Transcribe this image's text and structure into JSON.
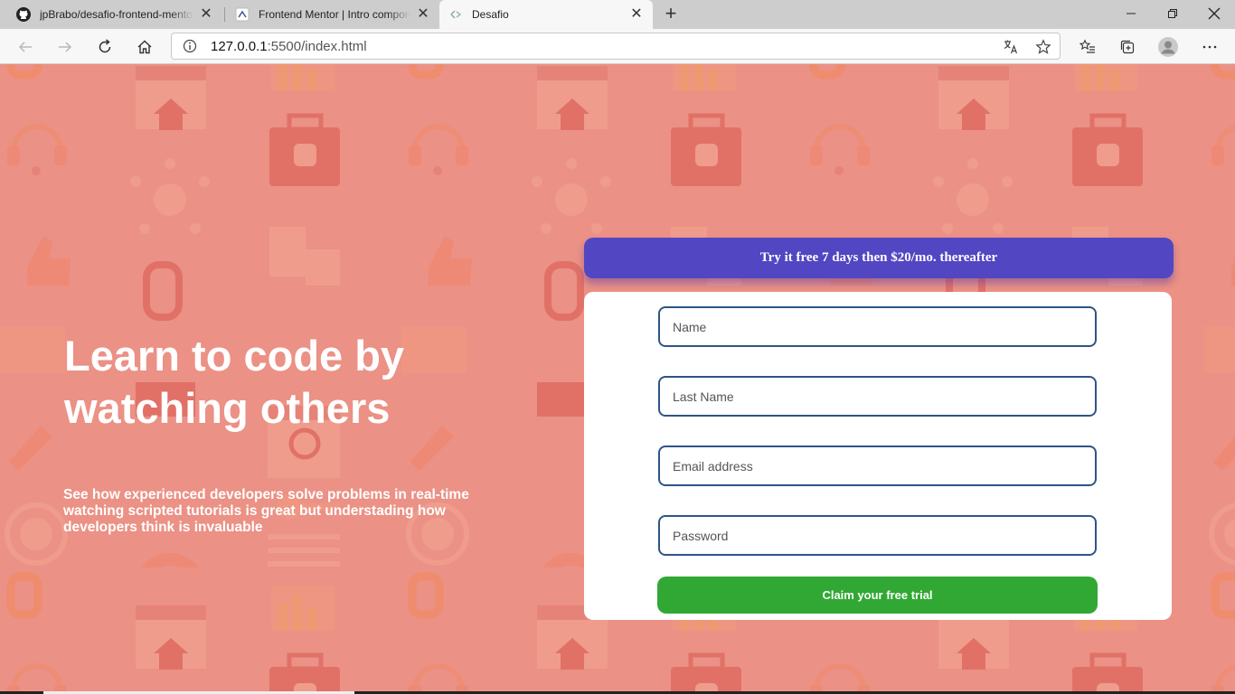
{
  "browser": {
    "tabs": [
      {
        "title": "jpBrabo/desafio-frontend-mento",
        "icon": "github-icon",
        "active": false
      },
      {
        "title": "Frontend Mentor | Intro compon",
        "icon": "frontend-mentor-icon",
        "active": false
      },
      {
        "title": "Desafio",
        "icon": "vscode-live-icon",
        "active": true
      }
    ],
    "url_host": "127.0.0.1",
    "url_rest": ":5500/index.html"
  },
  "hero": {
    "title": "Learn to code by watching others",
    "description": "See how experienced developers solve problems in real-time watching scripted tutorials is great but understading how developers think is invaluable"
  },
  "promo": {
    "text": "Try it free 7 days then $20/mo. thereafter"
  },
  "form": {
    "name_placeholder": "Name",
    "last_name_placeholder": "Last Name",
    "email_placeholder": "Email address",
    "password_placeholder": "Password",
    "submit_label": "Claim your free trial"
  },
  "colors": {
    "background": "#eb9185",
    "promo": "#5246c2",
    "button": "#31a834",
    "input_border": "#2f5488"
  }
}
